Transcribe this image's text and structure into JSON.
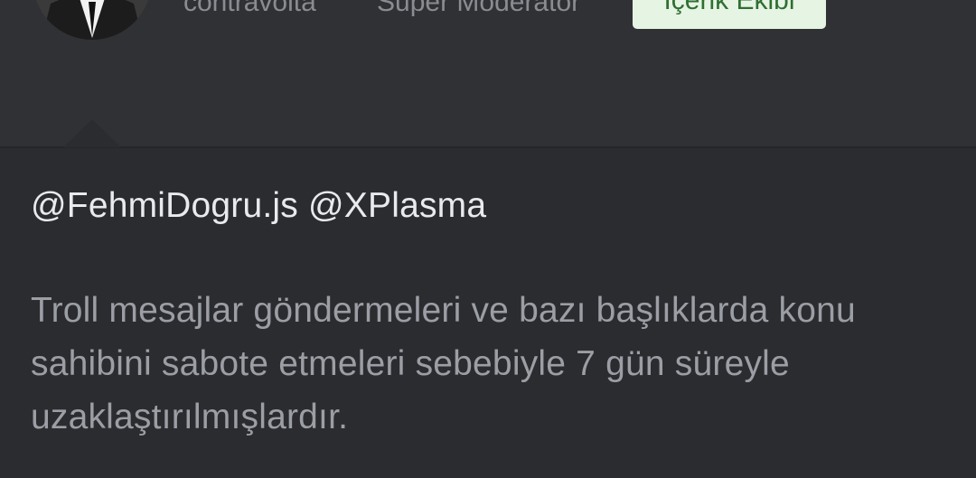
{
  "author": {
    "username": "contravolta",
    "role": "Super Moderatör",
    "team_badge": "İçerik Ekibi",
    "avatar_icon": "user-avatar"
  },
  "post": {
    "mentions": "@FehmiDogru.js @XPlasma",
    "message": "Troll mesajlar göndermeleri ve bazı başlıklarda konu sahibini sabote etmeleri sebebiyle 7 gün süreyle uzaklaştırılmışlardır."
  },
  "colors": {
    "background": "#2c2d31",
    "text_primary": "#e9eaee",
    "text_secondary": "#9b9ea4",
    "badge_bg": "#e6f4e3",
    "badge_text": "#2f6f32"
  }
}
